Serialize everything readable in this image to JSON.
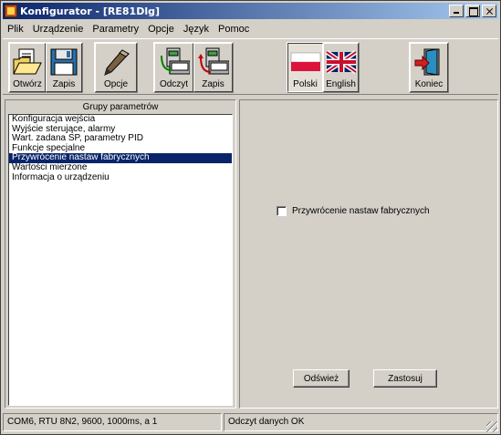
{
  "window": {
    "title": "Konfigurator - [RE81Dlg]"
  },
  "menu": [
    "Plik",
    "Urządzenie",
    "Parametry",
    "Opcje",
    "Język",
    "Pomoc"
  ],
  "toolbar": {
    "open_label": "Otwórz",
    "save_label": "Zapis",
    "options_label": "Opcje",
    "read_label": "Odczyt",
    "write_label": "Zapis",
    "polish_label": "Polski",
    "english_label": "English",
    "exit_label": "Koniec"
  },
  "left_panel": {
    "header": "Grupy parametrów",
    "items": [
      "Konfiguracja wejścia",
      "Wyjście sterujące, alarmy",
      "Wart. zadana SP, parametry PID",
      "Funkcje specjalne",
      "Przywrócenie nastaw fabrycznych",
      "Wartości mierzone",
      "Informacja o urządzeniu"
    ],
    "selected_index": 4
  },
  "right_panel": {
    "checkbox_label": "Przywrócenie nastaw fabrycznych",
    "checkbox_checked": false,
    "refresh_label": "Odśwież",
    "apply_label": "Zastosuj"
  },
  "status": {
    "connection": "COM6, RTU 8N2, 9600, 1000ms, a 1",
    "message": "Odczyt danych OK"
  },
  "colors": {
    "titlebar_start": "#0a246a",
    "titlebar_end": "#a6caf0",
    "selection": "#0a246a",
    "face": "#d4d0c8"
  }
}
